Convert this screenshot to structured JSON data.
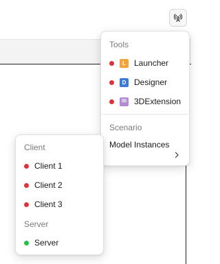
{
  "colors": {
    "status_red": "#e0303a",
    "status_green": "#1fc24b",
    "launcher_icon": "#f2a33a",
    "designer_icon": "#3b78d8",
    "extension_icon": "#b48ad6"
  },
  "toolbar": {
    "antenna_icon": "broadcast-antenna-icon"
  },
  "tools_menu": {
    "tools_heading": "Tools",
    "items": [
      {
        "label": "Launcher",
        "icon": "launcher-icon",
        "icon_glyph": "L",
        "status": "red"
      },
      {
        "label": "Designer",
        "icon": "designer-icon",
        "icon_glyph": "D",
        "status": "red"
      },
      {
        "label": "3DExtension",
        "icon": "3dextension-icon",
        "icon_glyph": "3D",
        "status": "red"
      }
    ],
    "scenario_heading": "Scenario",
    "model_instances_label": "Model Instances",
    "submenu_icon": "chevron-right-icon"
  },
  "client_menu": {
    "client_heading": "Client",
    "clients": [
      {
        "label": "Client 1",
        "status": "red"
      },
      {
        "label": "Client 2",
        "status": "red"
      },
      {
        "label": "Client 3",
        "status": "red"
      }
    ],
    "server_heading": "Server",
    "servers": [
      {
        "label": "Server",
        "status": "green"
      }
    ]
  }
}
